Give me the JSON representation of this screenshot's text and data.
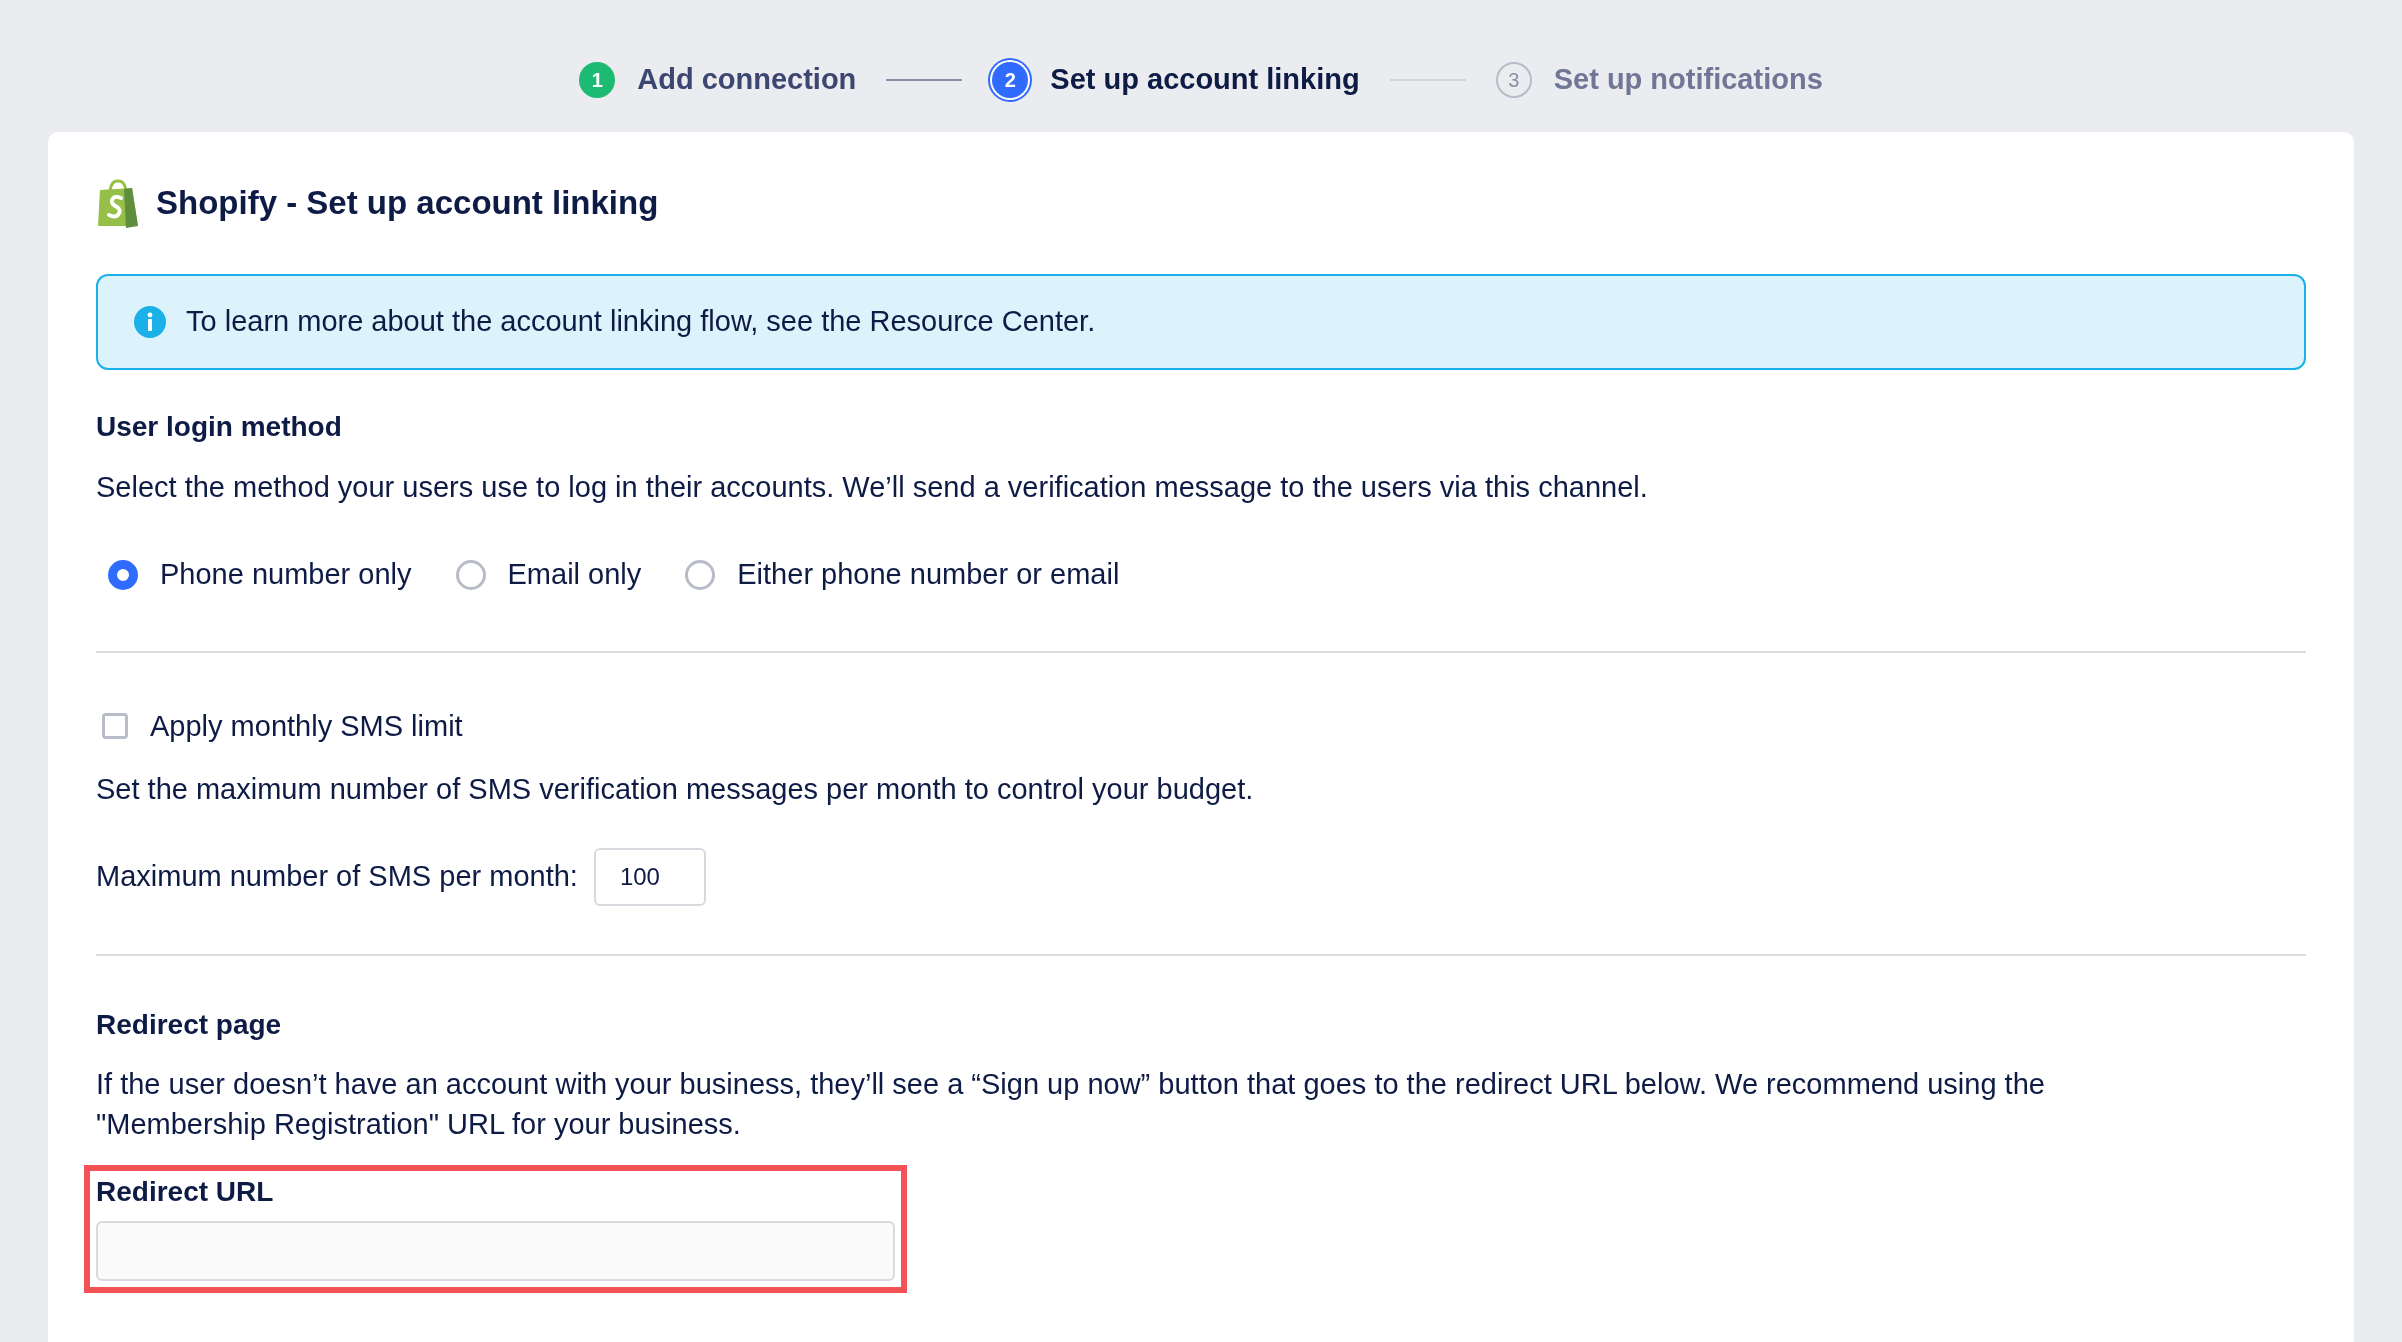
{
  "steps": [
    {
      "number": "1",
      "label": "Add connection",
      "kind": "done"
    },
    {
      "number": "2",
      "label": "Set up account linking",
      "kind": "active"
    },
    {
      "number": "3",
      "label": "Set up notifications",
      "kind": "pending"
    }
  ],
  "card": {
    "title": "Shopify - Set up account linking",
    "info": "To learn more about the account linking flow, see the Resource Center.",
    "login": {
      "heading": "User login method",
      "description": "Select the method your users use to log in their accounts. We’ll send a verification message to the users via this channel.",
      "options": [
        {
          "label": "Phone number only",
          "selected": true
        },
        {
          "label": "Email only",
          "selected": false
        },
        {
          "label": "Either phone number or email",
          "selected": false
        }
      ]
    },
    "sms": {
      "checkbox": {
        "label": "Apply monthly SMS limit",
        "checked": false
      },
      "description": "Set the maximum number of SMS verification messages per month to control your budget.",
      "field_label": "Maximum number of SMS per month:",
      "value": "100"
    },
    "redirect": {
      "heading": "Redirect page",
      "description": "If the user doesn’t have an account with your business, they’ll see a “Sign up now” button that goes to the redirect URL below. We recommend using the \"Membership Registration\" URL for your business.",
      "field": {
        "label": "Redirect URL",
        "highlighted": true
      }
    }
  }
}
